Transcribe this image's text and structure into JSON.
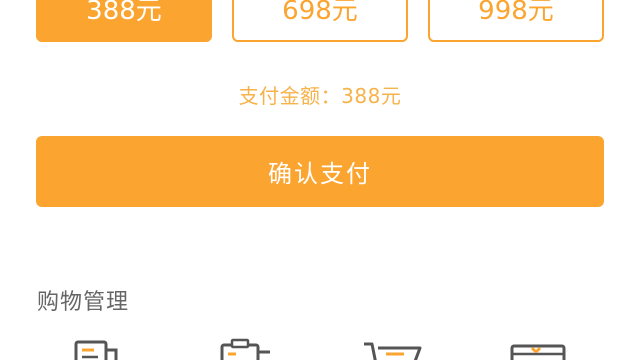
{
  "options": [
    {
      "label": "388元",
      "selected": true
    },
    {
      "label": "698元",
      "selected": false
    },
    {
      "label": "998元",
      "selected": false
    }
  ],
  "payment": {
    "amount_text": "支付金额：388元"
  },
  "confirm_button": {
    "label": "确认支付"
  },
  "shopping_section": {
    "title": "购物管理",
    "icons": [
      "document-icon",
      "clipboard-icon",
      "cart-icon",
      "box-icon"
    ]
  },
  "colors": {
    "accent": "#fba530",
    "amount_text": "#f7b24a",
    "section_title": "#666666",
    "icon_stroke": "#555555"
  }
}
